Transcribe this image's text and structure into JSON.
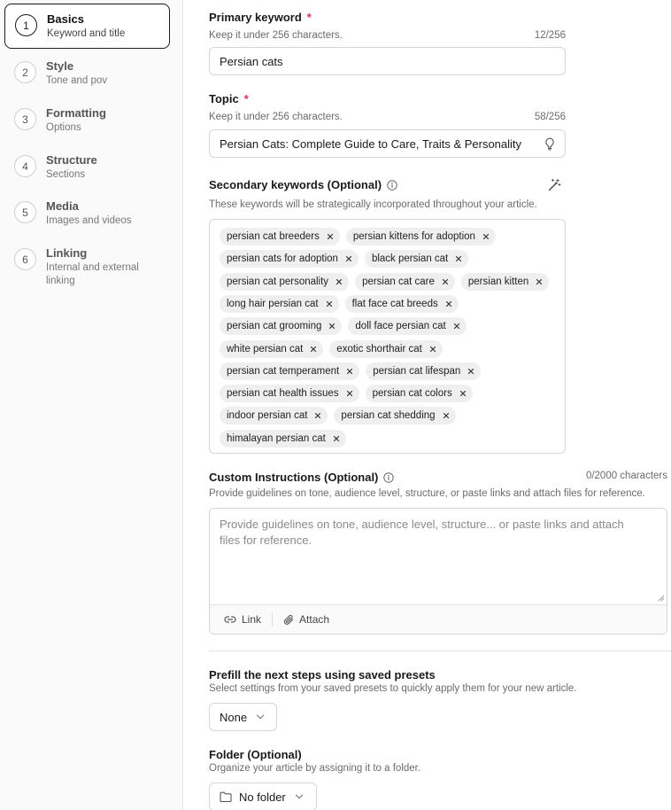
{
  "sidebar": {
    "steps": [
      {
        "num": "1",
        "title": "Basics",
        "sub": "Keyword and title"
      },
      {
        "num": "2",
        "title": "Style",
        "sub": "Tone and pov"
      },
      {
        "num": "3",
        "title": "Formatting",
        "sub": "Options"
      },
      {
        "num": "4",
        "title": "Structure",
        "sub": "Sections"
      },
      {
        "num": "5",
        "title": "Media",
        "sub": "Images and videos"
      },
      {
        "num": "6",
        "title": "Linking",
        "sub": "Internal and external linking"
      }
    ]
  },
  "primary_keyword": {
    "label": "Primary keyword",
    "required_mark": "*",
    "hint": "Keep it under 256 characters.",
    "count": "12/256",
    "value": "Persian cats"
  },
  "topic": {
    "label": "Topic",
    "required_mark": "*",
    "hint": "Keep it under 256 characters.",
    "count": "58/256",
    "value": "Persian Cats: Complete Guide to Care, Traits & Personality"
  },
  "secondary": {
    "label": "Secondary keywords (Optional)",
    "hint": "These keywords will be strategically incorporated throughout your article.",
    "chips": [
      "persian cat breeders",
      "persian kittens for adoption",
      "persian cats for adoption",
      "black persian cat",
      "persian cat personality",
      "persian cat care",
      "persian kitten",
      "long hair persian cat",
      "flat face cat breeds",
      "persian cat grooming",
      "doll face persian cat",
      "white persian cat",
      "exotic shorthair cat",
      "persian cat temperament",
      "persian cat lifespan",
      "persian cat health issues",
      "persian cat colors",
      "indoor persian cat",
      "persian cat shedding",
      "himalayan persian cat"
    ]
  },
  "custom": {
    "label": "Custom Instructions (Optional)",
    "count": "0/2000 characters",
    "hint": "Provide guidelines on tone, audience level, structure, or paste links and attach files for reference.",
    "placeholder": "Provide guidelines on tone, audience level, structure... or paste links and attach files for reference.",
    "link_label": "Link",
    "attach_label": "Attach"
  },
  "presets": {
    "label": "Prefill the next steps using saved presets",
    "hint": "Select settings from your saved presets to quickly apply them for your new article.",
    "value": "None"
  },
  "folder": {
    "label": "Folder (Optional)",
    "hint": "Organize your article by assigning it to a folder.",
    "value": "No folder"
  }
}
